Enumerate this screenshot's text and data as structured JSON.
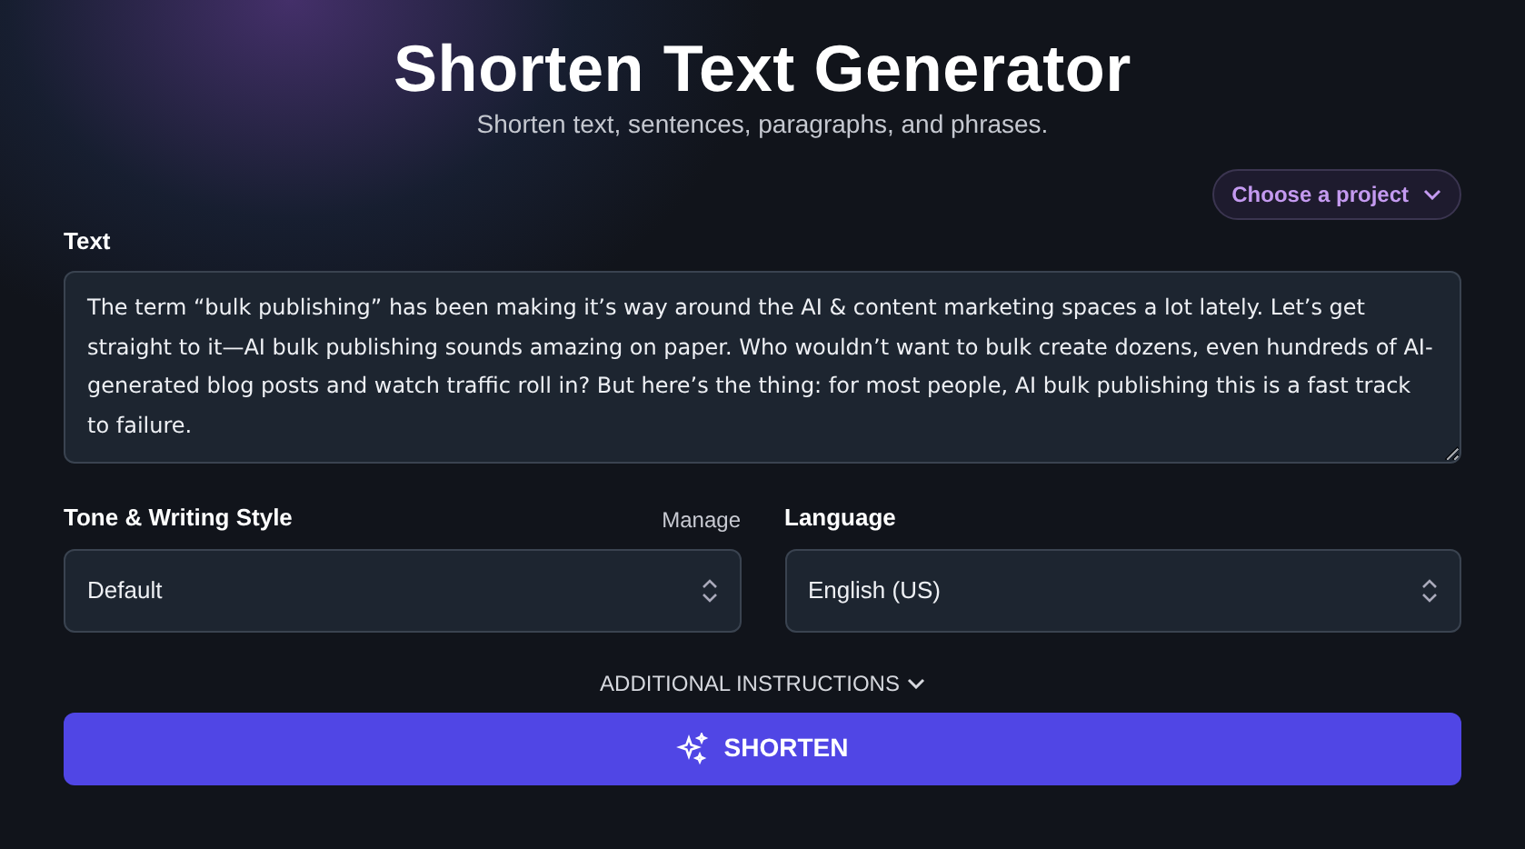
{
  "header": {
    "title": "Shorten Text Generator",
    "subtitle": "Shorten text, sentences, paragraphs, and phrases."
  },
  "project_button": {
    "label": "Choose a project"
  },
  "text_field": {
    "label": "Text",
    "value": "The term “bulk publishing” has been making it’s way around the AI & content marketing spaces a lot lately. Let’s get straight to it—AI bulk publishing sounds amazing on paper. Who wouldn’t want to bulk create dozens, even hundreds of AI-generated blog posts and watch traffic roll in? But here’s the thing: for most people, AI bulk publishing this is a fast track to failure."
  },
  "selects": [
    {
      "label": "Tone & Writing Style",
      "link": "Manage",
      "value": "Default"
    },
    {
      "label": "Language",
      "value": "English (US)"
    }
  ],
  "additional_instructions": {
    "label": "ADDITIONAL INSTRUCTIONS",
    "expanded": false
  },
  "submit_button": {
    "label": "SHORTEN"
  }
}
